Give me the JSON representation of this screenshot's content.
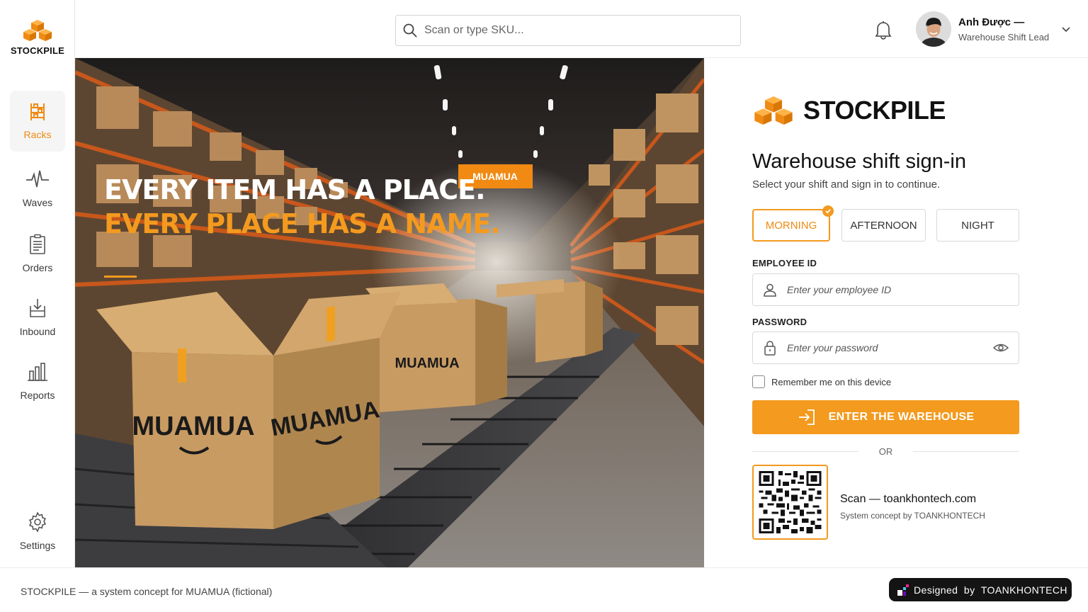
{
  "brand": {
    "name": "STOCKPILE",
    "accent": "#f39a1f",
    "logo_icon": "stacked-boxes-icon"
  },
  "sidebar": {
    "items": [
      {
        "label": "Racks",
        "icon": "racks-icon",
        "active": true
      },
      {
        "label": "Waves",
        "icon": "waves-icon",
        "active": false
      },
      {
        "label": "Orders",
        "icon": "orders-icon",
        "active": false
      },
      {
        "label": "Inbound",
        "icon": "inbound-icon",
        "active": false
      },
      {
        "label": "Reports",
        "icon": "reports-icon",
        "active": false
      }
    ],
    "settings_label": "Settings"
  },
  "header": {
    "search_placeholder": "Scan or type SKU...",
    "user_name": "Anh Được —",
    "user_role": "Warehouse Shift Lead"
  },
  "hero": {
    "line1": "EVERY ITEM HAS A PLACE.",
    "line2": "EVERY PLACE HAS A NAME.",
    "sign_text": "MUAMUA",
    "box_text": "MUAMUA"
  },
  "login": {
    "title": "Warehouse shift sign-in",
    "subtitle": "Select your shift and sign in to continue.",
    "shifts": [
      {
        "label": "MORNING",
        "selected": true
      },
      {
        "label": "AFTERNOON",
        "selected": false
      },
      {
        "label": "NIGHT",
        "selected": false
      }
    ],
    "employee_label": "EMPLOYEE ID",
    "employee_placeholder": "Enter your employee ID",
    "password_label": "PASSWORD",
    "password_placeholder": "Enter your password",
    "remember_label": "Remember me on this device",
    "submit_label": "ENTER THE WAREHOUSE",
    "or_label": "OR",
    "qr_title": "Scan — toankhontech.com",
    "qr_subtitle": "System concept by TOANKHONTECH"
  },
  "footer": {
    "text": "STOCKPILE — a system concept for MUAMUA (fictional)",
    "designed_by": "Designed  by  TOANKHONTECH"
  }
}
